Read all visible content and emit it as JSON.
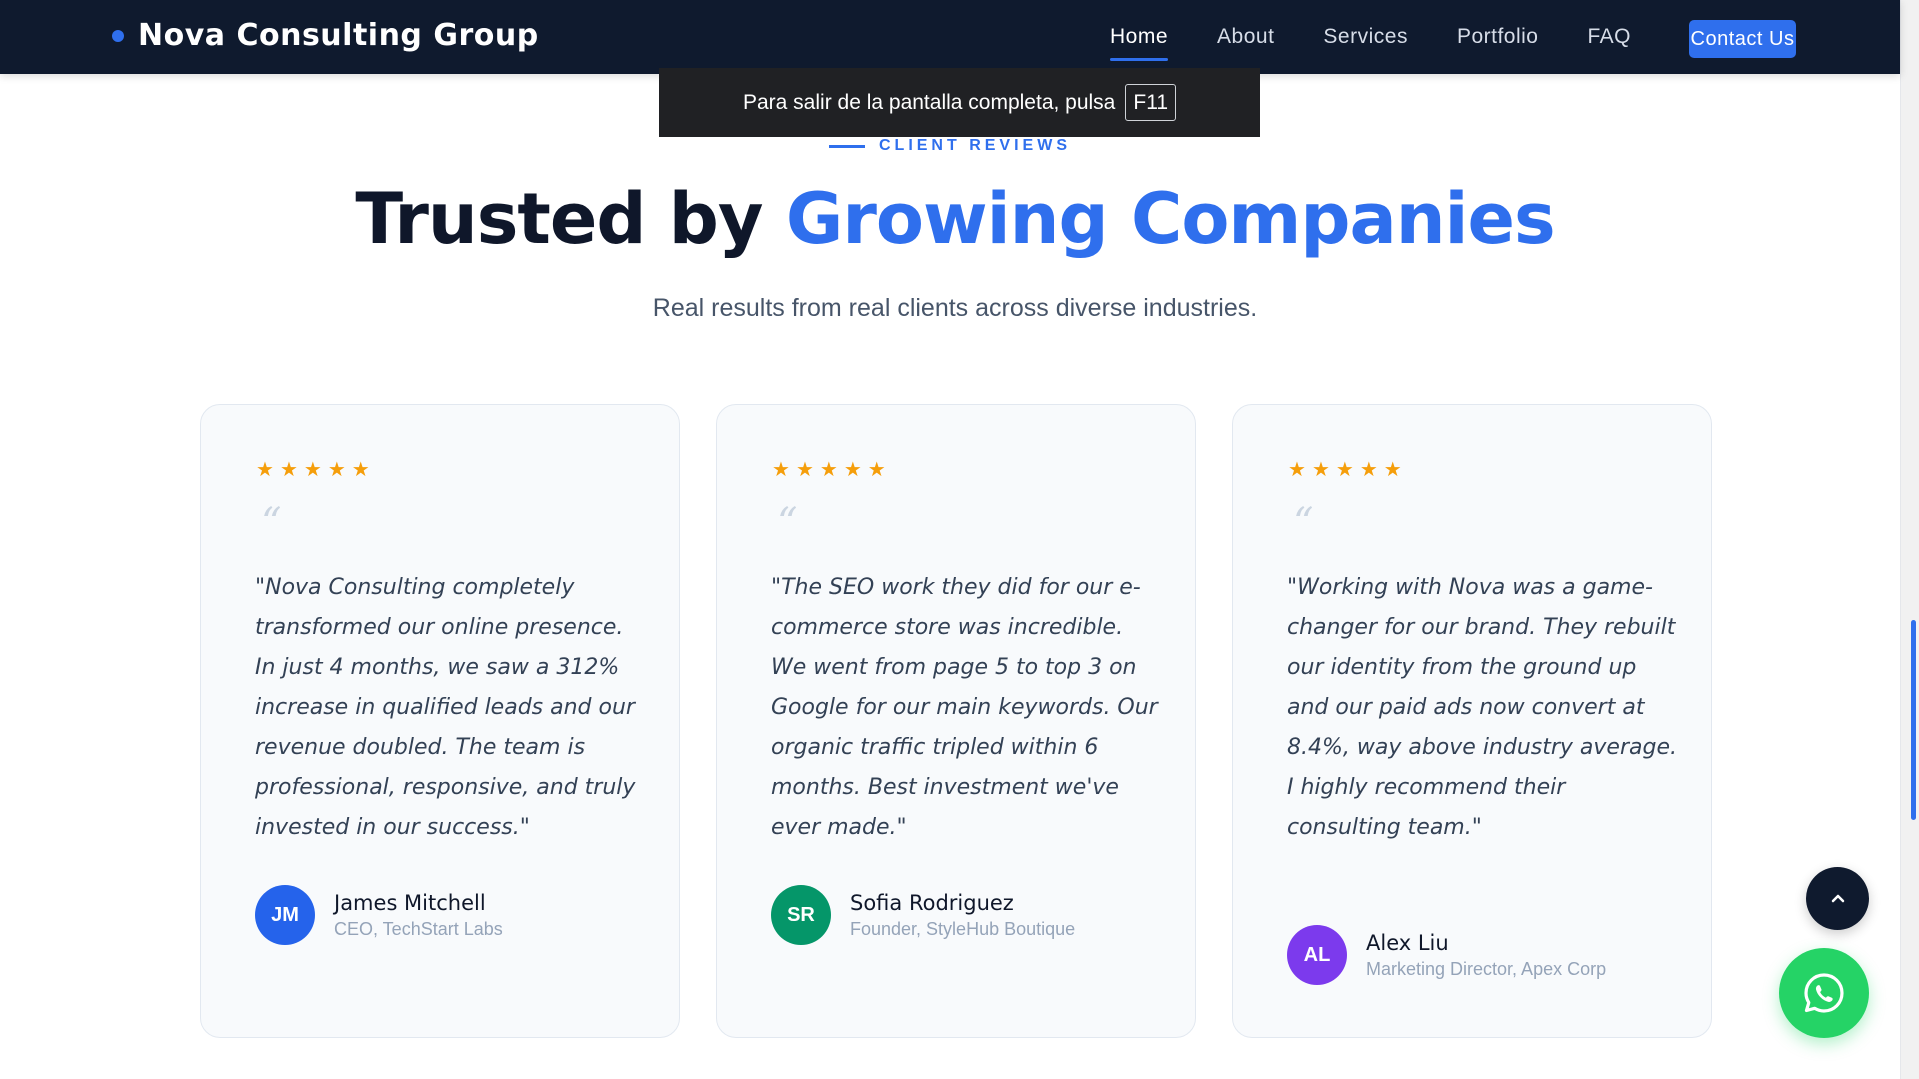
{
  "header": {
    "logo_text": "Nova Consulting Group",
    "nav": [
      "Home",
      "About",
      "Services",
      "Portfolio",
      "FAQ"
    ],
    "active_nav": "Home",
    "contact_label": "Contact Us"
  },
  "fullscreen_notice": {
    "message": "Para salir de la pantalla completa, pulsa",
    "key": "F11"
  },
  "section": {
    "eyebrow": "CLIENT REVIEWS",
    "title_part1": "Trusted by",
    "title_accent": "Growing Companies",
    "subtitle": "Real results from real clients across diverse industries."
  },
  "testimonials": [
    {
      "rating": 5,
      "quote": "\"Nova Consulting completely transformed our online presence. In just 4 months, we saw a 312% increase in qualified leads and our revenue doubled. The team is professional, responsive, and truly invested in our success.\"",
      "initials": "JM",
      "name": "James Mitchell",
      "role": "CEO, TechStart Labs",
      "avatar_color": "#2563eb"
    },
    {
      "rating": 5,
      "quote": "\"The SEO work they did for our e-commerce store was incredible. We went from page 5 to top 3 on Google for our main keywords. Our organic traffic tripled within 6 months. Best investment we've ever made.\"",
      "initials": "SR",
      "name": "Sofia Rodriguez",
      "role": "Founder, StyleHub Boutique",
      "avatar_color": "#059669"
    },
    {
      "rating": 5,
      "quote": "\"Working with Nova was a game-changer for our brand. They rebuilt our identity from the ground up and our paid ads now convert at 8.4%, way above industry average. I highly recommend their consulting team.\"",
      "initials": "AL",
      "name": "Alex Liu",
      "role": "Marketing Director, Apex Corp",
      "avatar_color": "#7c3aed"
    }
  ],
  "colors": {
    "brand": "#2f6fed",
    "header_bg": "#0f1a2e",
    "star": "#f59e0b",
    "whatsapp": "#25d366"
  },
  "icons": {
    "quote": "quote-icon",
    "star": "star-icon",
    "scroll_top": "chevron-up-icon",
    "chat": "whatsapp-icon"
  }
}
